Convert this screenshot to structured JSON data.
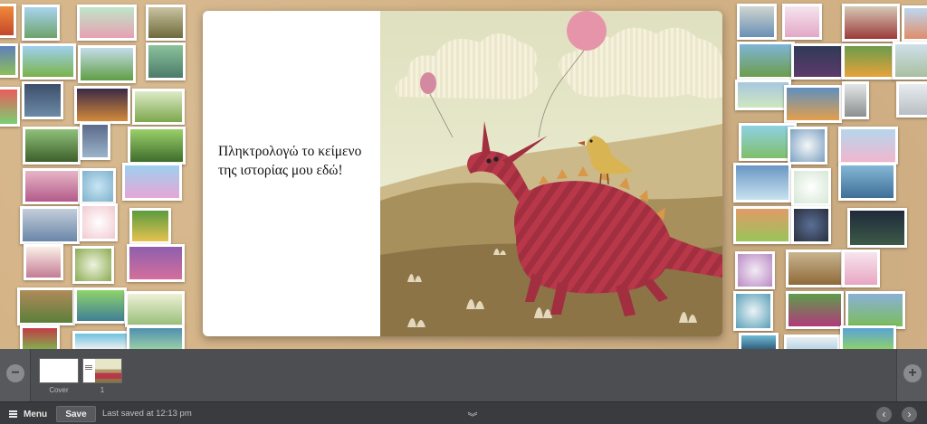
{
  "book": {
    "story_text": "Πληκτρολογώ το κείμενο της ιστορίας μου εδώ!"
  },
  "pages": [
    {
      "label": "Cover",
      "kind": "blank"
    },
    {
      "label": "1",
      "kind": "spread"
    }
  ],
  "strip": {
    "zoom_out_icon": "minus-icon",
    "zoom_in_icon": "plus-icon"
  },
  "toolbar": {
    "menu_label": "Menu",
    "save_label": "Save",
    "saved_status": "Last saved at 12:13 pm"
  },
  "colors": {
    "board": "#d4b386",
    "strip": "#4d4e52",
    "toolbar": "#3a3b3e",
    "dragon": "#b8384a",
    "sky": "#eef0d2"
  },
  "thumbnails_left": [
    {
      "color": "#5e7fb9"
    },
    {
      "color": "#8fc6a4"
    },
    {
      "color": "#e6a0b2"
    },
    {
      "color": "#6f8c3b"
    },
    {
      "color": "#5a9ecf"
    },
    {
      "color": "#7ab34a"
    },
    {
      "color": "#cf5a74"
    },
    {
      "color": "#8bc29b"
    },
    {
      "color": "#5a7b2e"
    },
    {
      "color": "#3d5f2c"
    },
    {
      "color": "#d48a3a"
    },
    {
      "color": "#7da74c"
    },
    {
      "color": "#5f9e44"
    },
    {
      "color": "#b45a8a"
    },
    {
      "color": "#9dd0ef"
    },
    {
      "color": "#6aa7d4"
    },
    {
      "color": "#c4cedb"
    },
    {
      "color": "#e6c24f"
    },
    {
      "color": "#8e5fae"
    },
    {
      "color": "#c37c94"
    },
    {
      "color": "#8aaa52"
    },
    {
      "color": "#5b7f3a"
    },
    {
      "color": "#9ac07b"
    },
    {
      "color": "#3f7f96"
    },
    {
      "color": "#c23c46"
    },
    {
      "color": "#6cc2de"
    },
    {
      "color": "#4f8fb0"
    }
  ],
  "thumbnails_right": [
    {
      "color": "#6a8fb5"
    },
    {
      "color": "#e2a8c6"
    },
    {
      "color": "#9c3a3a"
    },
    {
      "color": "#bcd8ef"
    },
    {
      "color": "#7fb5d6"
    },
    {
      "color": "#2f3a58"
    },
    {
      "color": "#e7a33a"
    },
    {
      "color": "#cfe0ea"
    },
    {
      "color": "#a7c8df"
    },
    {
      "color": "#e3a04c"
    },
    {
      "color": "#5e8fbf"
    },
    {
      "color": "#d8d8d8"
    },
    {
      "color": "#8fd1e3"
    },
    {
      "color": "#7ba0c2"
    },
    {
      "color": "#f0b7cf"
    },
    {
      "color": "#b5d6ec"
    },
    {
      "color": "#6a96c4"
    },
    {
      "color": "#84b7d6"
    },
    {
      "color": "#e09b67"
    },
    {
      "color": "#2a2f3e"
    },
    {
      "color": "#1f2a3a"
    },
    {
      "color": "#b98ac4"
    },
    {
      "color": "#8f6a3a"
    },
    {
      "color": "#e8a6c2"
    },
    {
      "color": "#5a9fb8"
    },
    {
      "color": "#5e9d4c"
    },
    {
      "color": "#8ab0d8"
    },
    {
      "color": "#6fbbd6"
    },
    {
      "color": "#5aa3d6"
    }
  ]
}
